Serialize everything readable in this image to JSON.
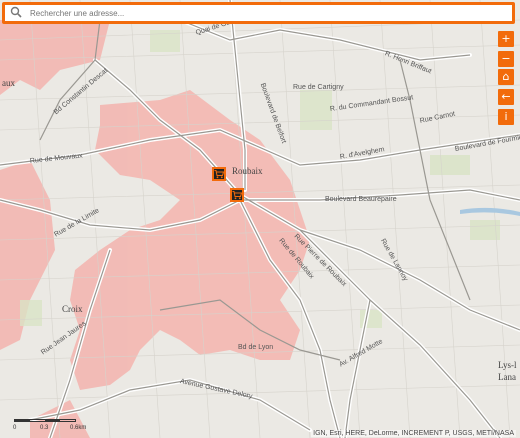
{
  "search": {
    "placeholder": "Rechercher une adresse..."
  },
  "controls": [
    {
      "name": "zoom-in-button",
      "icon": "+"
    },
    {
      "name": "zoom-out-button",
      "icon": "−"
    },
    {
      "name": "home-button",
      "icon": "⌂"
    },
    {
      "name": "back-button",
      "icon": "←"
    },
    {
      "name": "info-button",
      "icon": "i"
    }
  ],
  "map": {
    "places": [
      "Roubaix",
      "Croix",
      "Lys-l",
      "Lana",
      "aux"
    ],
    "streets": [
      "Quai de Gand",
      "R. Henri Briffaut",
      "Rue de Cartigny",
      "Rue Carnot",
      "Boulevard de Fourmies",
      "R. du Commandant Bossut",
      "Rue de Mouvaux",
      "R. d'Avelghem",
      "Boulevard Beaurepaire",
      "Rue de la Limite",
      "Rue Jean Jaures",
      "Bd de Lyon",
      "Avenue Gustave Delory",
      "Rue de Roubaix",
      "Av. Alfred Motte",
      "Boulevard de Belfort",
      "Rue Pierre de Roubaix",
      "Bd Constantin Descat",
      "Rue de Lannoy"
    ]
  },
  "poi_icon": "shopping-cart-icon",
  "colors": {
    "accent": "#f26b0b",
    "zone": "#f4b4ae"
  },
  "scale": {
    "labels": [
      "0",
      "0.3",
      "0.6km"
    ]
  },
  "attribution": "IGN, Esri, HERE, DeLorme, INCREMENT P, USGS, METI/NASA"
}
